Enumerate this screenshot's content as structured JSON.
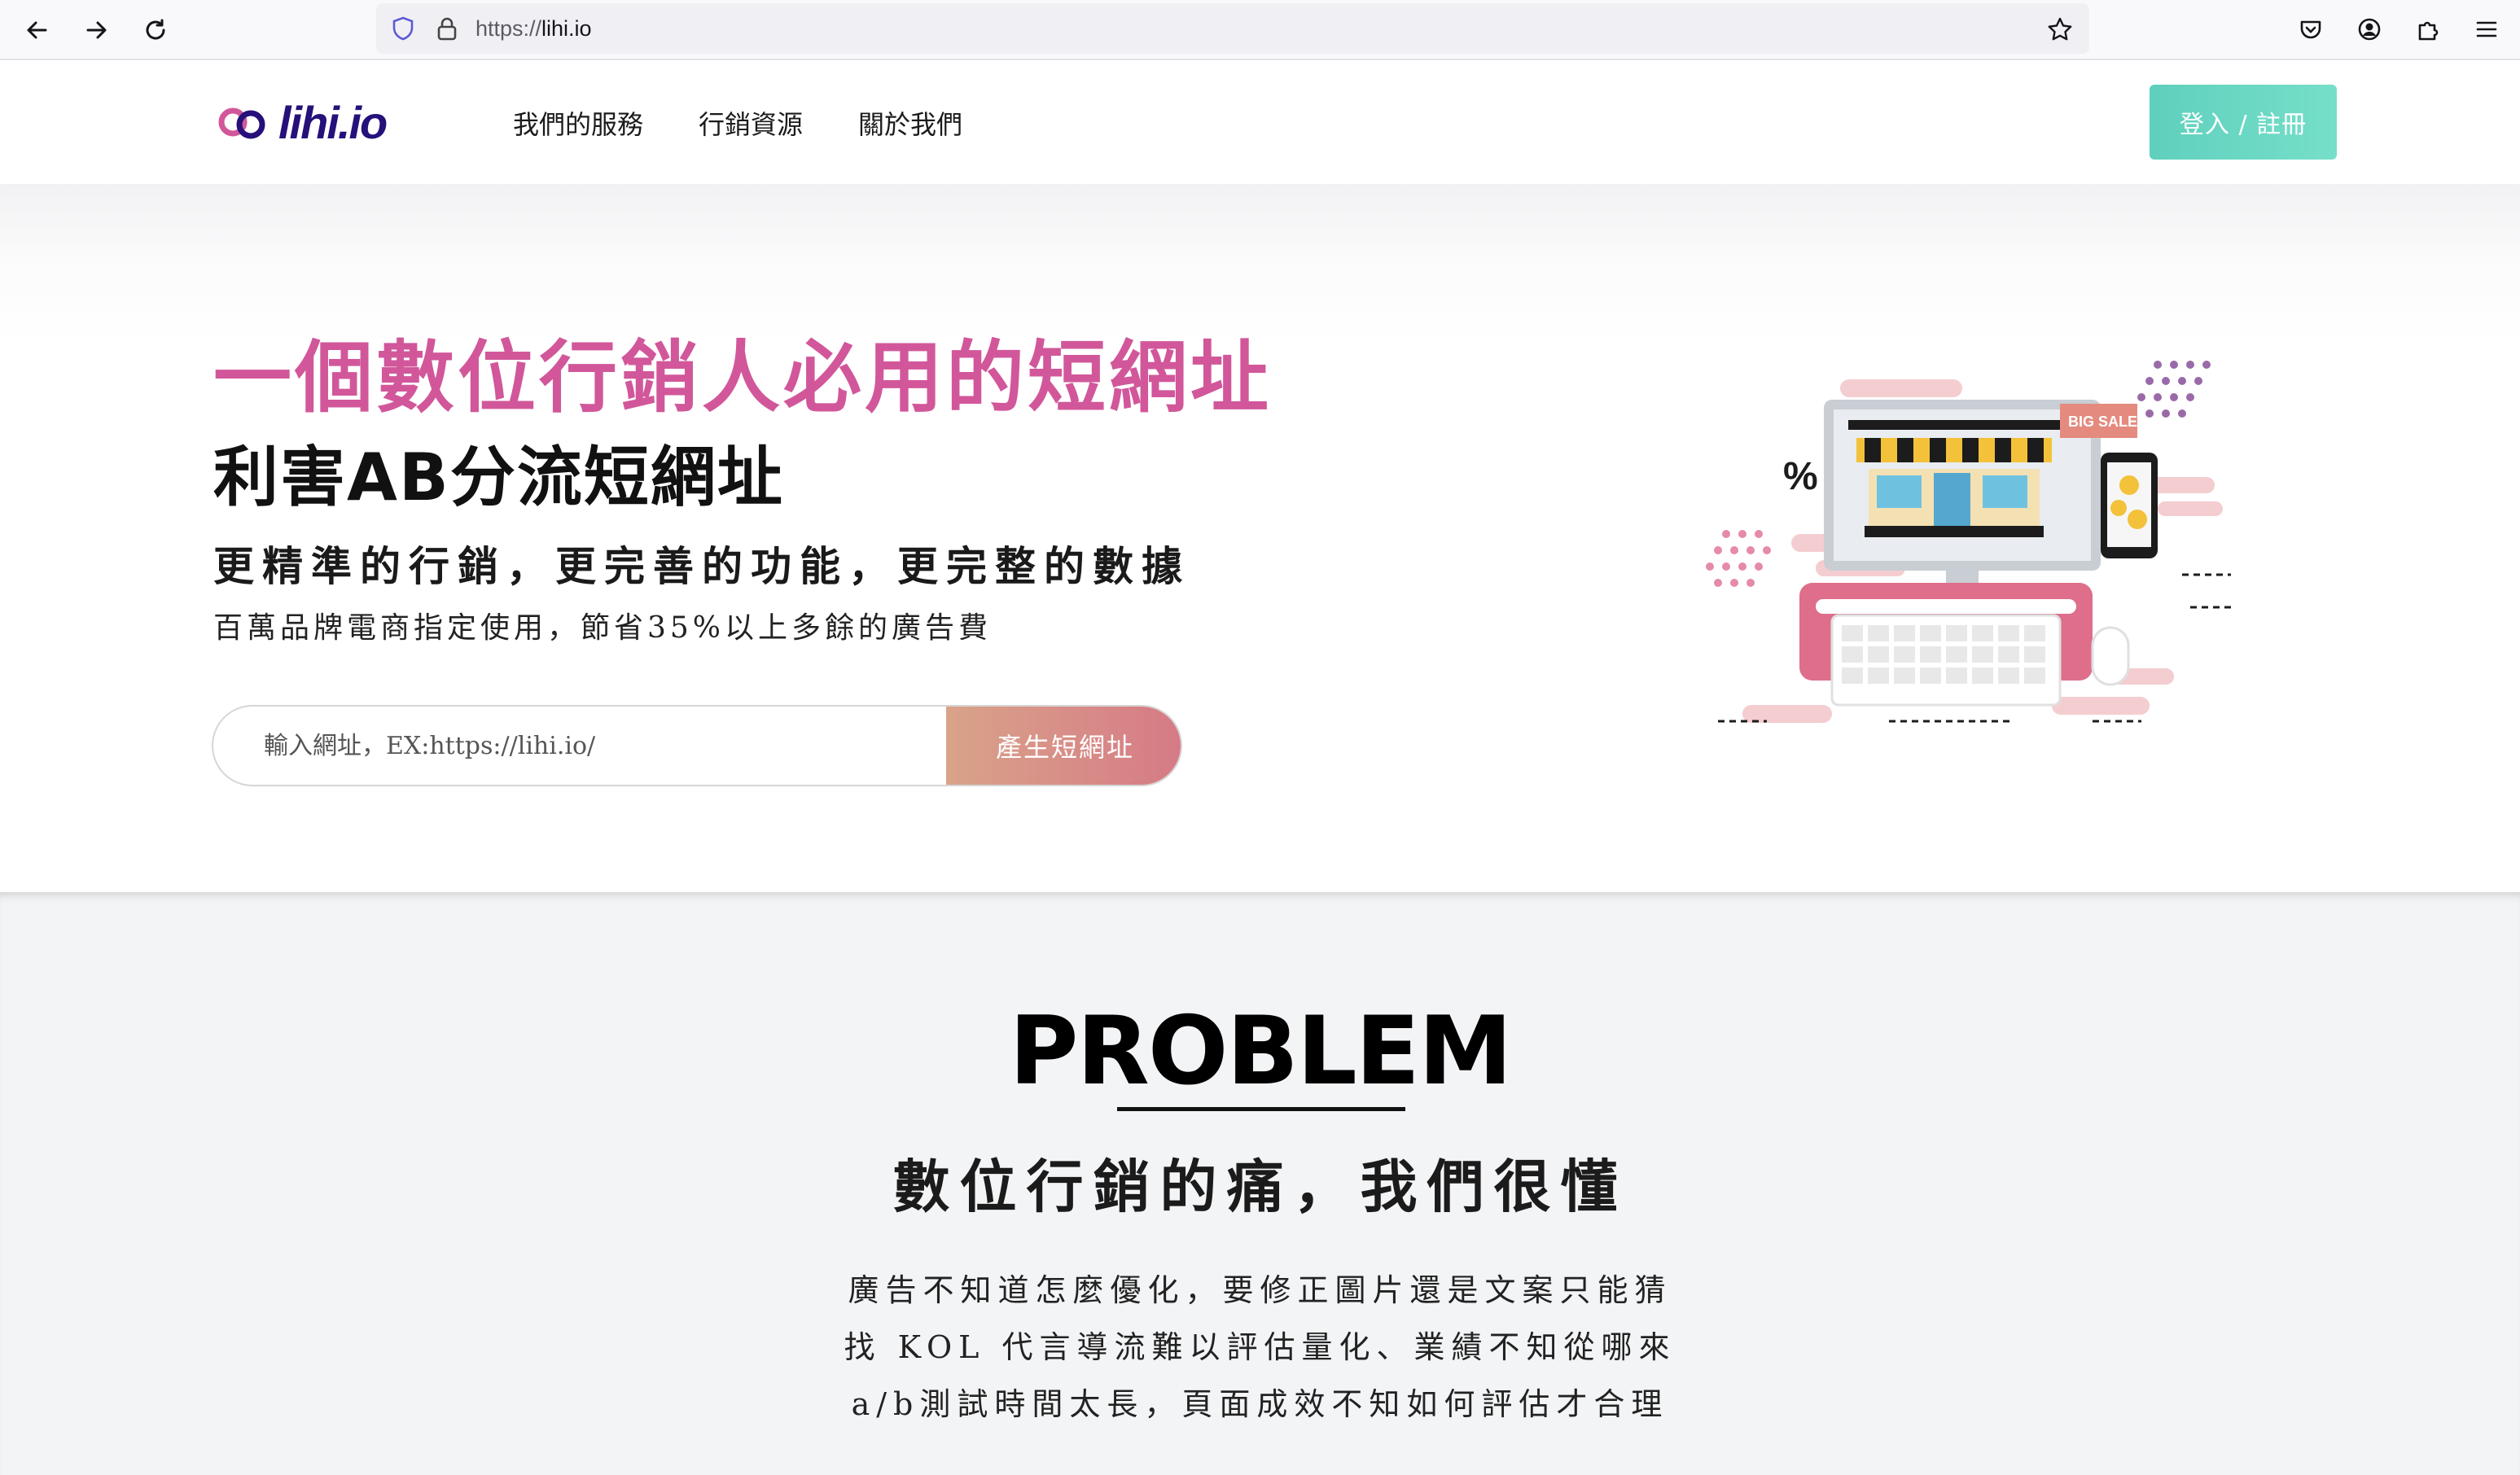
{
  "browser": {
    "url_scheme": "https://",
    "url_host": "lihi.io",
    "icons": [
      "back-arrow-icon",
      "forward-arrow-icon",
      "reload-icon",
      "shield-icon",
      "lock-icon",
      "star-icon",
      "pocket-icon",
      "account-icon",
      "extensions-icon",
      "menu-icon"
    ]
  },
  "header": {
    "logo_text": "lihi.io",
    "nav": [
      {
        "label": "我們的服務"
      },
      {
        "label": "行銷資源"
      },
      {
        "label": "關於我們"
      }
    ],
    "login_label": "登入 / 註冊"
  },
  "hero": {
    "title": "一個數位行銷人必用的短網址",
    "subtitle": "利害AB分流短網址",
    "tagline": "更精準的行銷，更完善的功能，更完整的數據",
    "description": "百萬品牌電商指定使用，節省35%以上多餘的廣告費",
    "url_placeholder": "輸入網址，EX:https://lihi.io/",
    "generate_label": "產生短網址",
    "illustration_badge": "BIG SALE"
  },
  "problem": {
    "title": "PROBLEM",
    "subtitle": "數位行銷的痛，我們很懂",
    "lines": [
      "廣告不知道怎麼優化，要修正圖片還是文案只能猜",
      "找 KOL 代言導流難以評估量化、業績不知從哪來",
      "a/b測試時間太長，頁面成效不知如何評估才合理"
    ]
  },
  "colors": {
    "brand_pink": "#d1579a",
    "login_teal": "#6ad8c3",
    "generate_gradient_start": "#d9a389",
    "generate_gradient_end": "#d67a86"
  }
}
